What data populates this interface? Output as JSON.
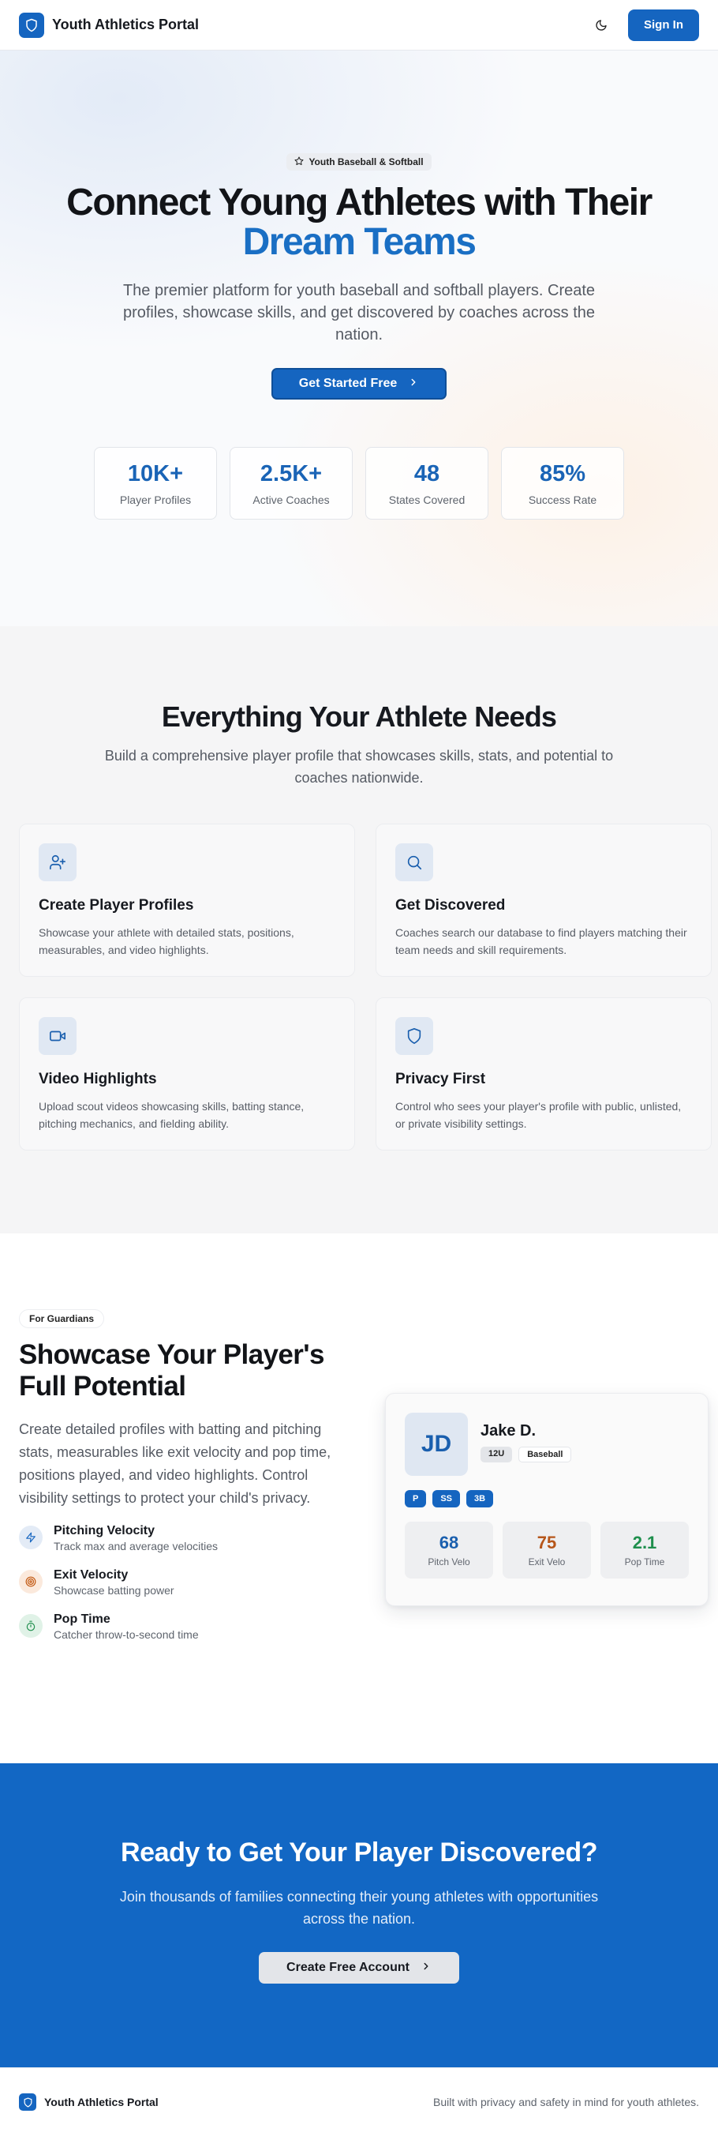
{
  "header": {
    "brand": "Youth Athletics Portal",
    "signin_label": "Sign In"
  },
  "hero": {
    "badge": "Youth Baseball & Softball",
    "title_line1": "Connect Young Athletes with Their",
    "title_line2": "Dream Teams",
    "subtitle": "The premier platform for youth baseball and softball players. Create profiles, showcase skills, and get discovered by coaches across the nation.",
    "cta_label": "Get Started Free",
    "stats": [
      {
        "value": "10K+",
        "label": "Player Profiles"
      },
      {
        "value": "2.5K+",
        "label": "Active Coaches"
      },
      {
        "value": "48",
        "label": "States Covered"
      },
      {
        "value": "85%",
        "label": "Success Rate"
      }
    ]
  },
  "features": {
    "title": "Everything Your Athlete Needs",
    "subtitle": "Build a comprehensive player profile that showcases skills, stats, and potential to coaches nationwide.",
    "items": [
      {
        "icon": "user-plus-icon",
        "title": "Create Player Profiles",
        "desc": "Showcase your athlete with detailed stats, positions, measurables, and video highlights."
      },
      {
        "icon": "search-icon",
        "title": "Get Discovered",
        "desc": "Coaches search our database to find players matching their team needs and skill requirements."
      },
      {
        "icon": "video-icon",
        "title": "Video Highlights",
        "desc": "Upload scout videos showcasing skills, batting stance, pitching mechanics, and fielding ability."
      },
      {
        "icon": "shield-icon",
        "title": "Privacy First",
        "desc": "Control who sees your player's profile with public, unlisted, or private visibility settings."
      }
    ]
  },
  "guardians": {
    "pill": "For Guardians",
    "title": "Showcase Your Player's Full Potential",
    "desc": "Create detailed profiles with batting and pitching stats, measurables like exit velocity and pop time, positions played, and video highlights. Control visibility settings to protect your child's privacy.",
    "items": [
      {
        "icon": "zap-icon",
        "title": "Pitching Velocity",
        "sub": "Track max and average velocities",
        "color": "#1565c0"
      },
      {
        "icon": "target-icon",
        "title": "Exit Velocity",
        "sub": "Showcase batting power",
        "color": "#c2570f"
      },
      {
        "icon": "timer-icon",
        "title": "Pop Time",
        "sub": "Catcher throw-to-second time",
        "color": "#1f8f4d"
      }
    ],
    "profile": {
      "initials": "JD",
      "name": "Jake D.",
      "tags": [
        "12U",
        "Baseball"
      ],
      "positions": [
        "P",
        "SS",
        "3B"
      ],
      "metrics": [
        {
          "value": "68",
          "label": "Pitch Velo",
          "color": "#1a5fae"
        },
        {
          "value": "75",
          "label": "Exit Velo",
          "color": "#b6561a"
        },
        {
          "value": "2.1",
          "label": "Pop Time",
          "color": "#1f8f4d"
        }
      ]
    }
  },
  "cta": {
    "title": "Ready to Get Your Player Discovered?",
    "subtitle": "Join thousands of families connecting their young athletes with opportunities across the nation.",
    "button_label": "Create Free Account"
  },
  "footer": {
    "brand": "Youth Athletics Portal",
    "note": "Built with privacy and safety in mind for youth athletes."
  }
}
